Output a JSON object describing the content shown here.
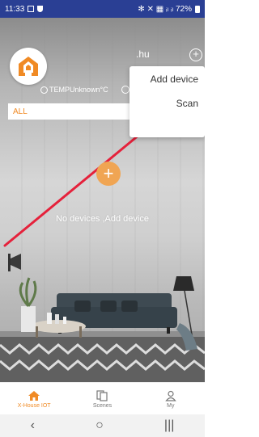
{
  "status_bar": {
    "time": "11:33",
    "right_text": "✻ ✕ ▦ ᵢₗ ᵢₗ 72%"
  },
  "header": {
    "device_name": ".hu",
    "temperature_text": "TEMPUnknown°C"
  },
  "dropdown_menu": {
    "items": [
      {
        "label": "Add device"
      },
      {
        "label": "Scan"
      }
    ]
  },
  "room_bar": {
    "selected_room": "ALL",
    "more": "---"
  },
  "empty_state": {
    "message": "No devices ,Add device"
  },
  "bottom_nav": {
    "tabs": [
      {
        "label": "X-House IOT",
        "icon": "home-icon",
        "active": true
      },
      {
        "label": "Scenes",
        "icon": "scenes-icon",
        "active": false
      },
      {
        "label": "My",
        "icon": "profile-icon",
        "active": false
      }
    ]
  },
  "system_nav": {
    "back": "‹",
    "home": "○",
    "recents": "|||"
  },
  "colors": {
    "status_bar": "#2a3f94",
    "accent": "#f08a24",
    "annotation_arrow": "#e5213b"
  }
}
